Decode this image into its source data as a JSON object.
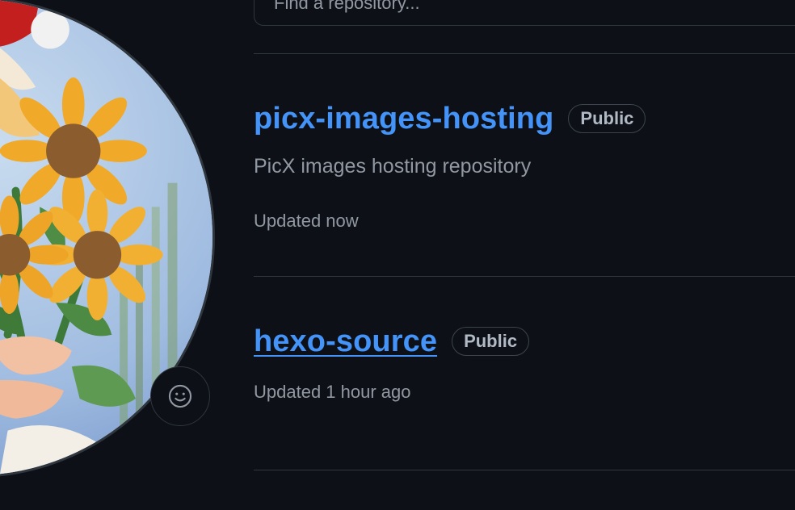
{
  "search": {
    "placeholder": "Find a repository..."
  },
  "profile": {
    "avatar_alt": "profile avatar",
    "status_icon": "smiley-icon"
  },
  "repositories": [
    {
      "name": "picx-images-hosting",
      "visibility": "Public",
      "description": "PicX images hosting repository",
      "updated": "Updated now"
    },
    {
      "name": "hexo-source",
      "visibility": "Public",
      "description": "",
      "updated": "Updated 1 hour ago"
    }
  ],
  "colors": {
    "background": "#0d1117",
    "border": "#30363d",
    "link": "#4493f8",
    "muted_text": "#9198a1"
  }
}
